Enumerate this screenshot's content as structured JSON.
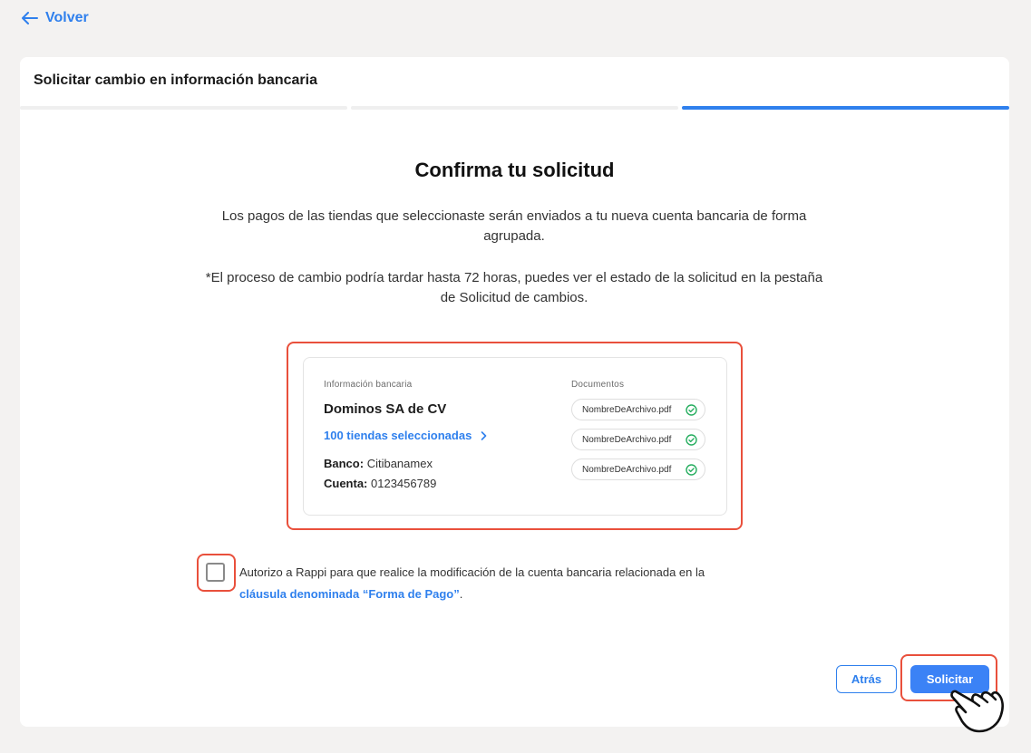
{
  "nav": {
    "back_label": "Volver"
  },
  "card": {
    "title": "Solicitar cambio en información bancaria",
    "steps_total": 3,
    "active_step": 3
  },
  "confirm": {
    "heading": "Confirma tu solicitud",
    "description_1": "Los pagos de las tiendas que seleccionaste serán enviados a tu nueva cuenta bancaria de forma agrupada.",
    "description_2": "*El proceso de cambio podría tardar hasta 72 horas, puedes ver el estado de la solicitud en la pestaña de Solicitud de cambios."
  },
  "bank_info": {
    "section_label": "Información bancaria",
    "company": "Dominos SA de CV",
    "stores_link": "100 tiendas seleccionadas",
    "bank_key": "Banco:",
    "bank_value": "Citibanamex",
    "account_key": "Cuenta:",
    "account_value": "0123456789"
  },
  "documents": {
    "section_label": "Documentos",
    "files": [
      {
        "name": "NombreDeArchivo.pdf",
        "status": "check-circle-icon"
      },
      {
        "name": "NombreDeArchivo.pdf",
        "status": "check-circle-icon"
      },
      {
        "name": "NombreDeArchivo.pdf",
        "status": "check-circle-icon"
      }
    ]
  },
  "consent": {
    "text": "Autorizo a Rappi para que realice la modificación de la cuenta bancaria relacionada en la",
    "link": "cláusula denominada “Forma de Pago”",
    "suffix": ".",
    "checked": false
  },
  "actions": {
    "back_label": "Atrás",
    "submit_label": "Solicitar"
  },
  "colors": {
    "accent": "#2f80ed",
    "highlight": "#e9503c",
    "success": "#27ae60",
    "background": "#f3f2f1"
  }
}
